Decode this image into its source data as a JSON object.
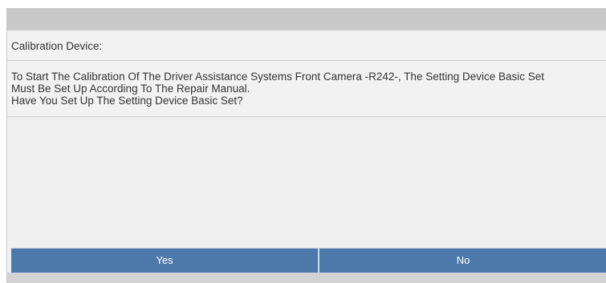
{
  "dialog": {
    "device_label": "Calibration Device:",
    "message_lines": [
      "To Start The Calibration Of The Driver Assistance Systems Front Camera -R242-, The Setting Device Basic Set",
      "Must Be Set Up According To The Repair Manual.",
      "Have You Set Up The Setting Device Basic Set?"
    ]
  },
  "buttons": {
    "yes_label": "Yes",
    "no_label": "No"
  },
  "colors": {
    "button_background": "#4d78aa",
    "button_text": "#ffffff",
    "header_bar": "#c8c8c8",
    "panel_background": "#f2f2f2"
  }
}
